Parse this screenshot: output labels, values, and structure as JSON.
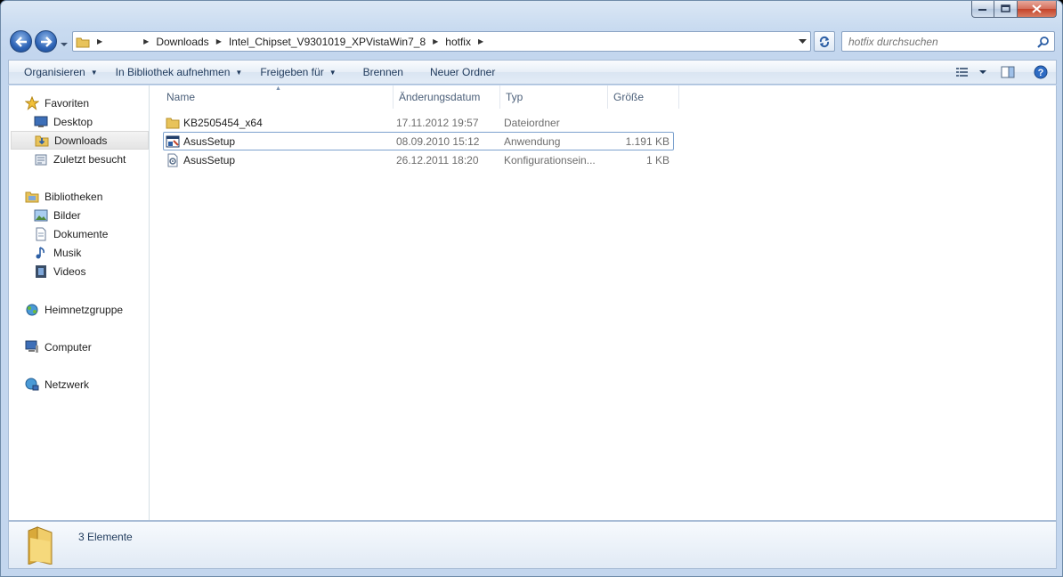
{
  "window": {
    "caption_buttons": {
      "minimize": "minimize",
      "maximize": "maximize",
      "close": "close"
    }
  },
  "address_bar": {
    "breadcrumbs": [
      "",
      "Downloads",
      "Intel_Chipset_V9301019_XPVistaWin7_8",
      "hotfix"
    ]
  },
  "search": {
    "placeholder": "hotfix durchsuchen"
  },
  "toolbar": {
    "items": [
      {
        "label": "Organisieren",
        "dropdown": true
      },
      {
        "label": "In Bibliothek aufnehmen",
        "dropdown": true
      },
      {
        "label": "Freigeben für",
        "dropdown": true
      },
      {
        "label": "Brennen",
        "dropdown": false
      },
      {
        "label": "Neuer Ordner",
        "dropdown": false
      }
    ]
  },
  "sidebar": {
    "favorites": {
      "label": "Favoriten"
    },
    "fav_items": [
      {
        "label": "Desktop",
        "icon": "desktop-icon"
      },
      {
        "label": "Downloads",
        "icon": "downloads-folder-icon",
        "selected": true
      },
      {
        "label": "Zuletzt besucht",
        "icon": "recent-places-icon"
      }
    ],
    "libraries": {
      "label": "Bibliotheken"
    },
    "lib_items": [
      {
        "label": "Bilder",
        "icon": "pictures-icon"
      },
      {
        "label": "Dokumente",
        "icon": "documents-icon"
      },
      {
        "label": "Musik",
        "icon": "music-icon"
      },
      {
        "label": "Videos",
        "icon": "videos-icon"
      }
    ],
    "homegroup": {
      "label": "Heimnetzgruppe"
    },
    "computer": {
      "label": "Computer"
    },
    "network": {
      "label": "Netzwerk"
    }
  },
  "columns": {
    "name": "Name",
    "date": "Änderungsdatum",
    "type": "Typ",
    "size": "Größe"
  },
  "files": [
    {
      "name": "KB2505454_x64",
      "date": "17.11.2012 19:57",
      "type": "Dateiordner",
      "size": "",
      "icon": "folder-icon"
    },
    {
      "name": "AsusSetup",
      "date": "08.09.2010 15:12",
      "type": "Anwendung",
      "size": "1.191 KB",
      "icon": "setup-application-icon"
    },
    {
      "name": "AsusSetup",
      "date": "26.12.2011 18:20",
      "type": "Konfigurationsein...",
      "size": "1 KB",
      "icon": "config-settings-icon"
    }
  ],
  "status": {
    "count": "3 Elemente"
  },
  "colors": {
    "accent": "#1e395b",
    "selection_border": "#7da2ce",
    "window_frame": "#c3d6ee"
  }
}
